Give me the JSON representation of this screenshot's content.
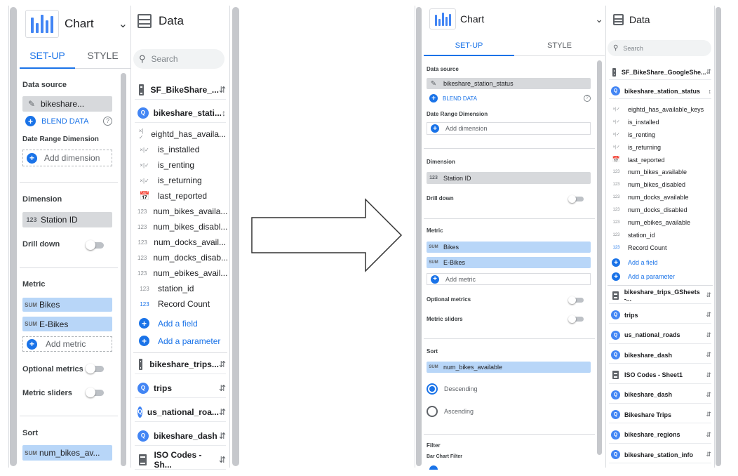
{
  "left": {
    "chart": {
      "title": "Chart"
    },
    "data": {
      "title": "Data",
      "search_placeholder": "Search"
    },
    "tabs": {
      "setup": "SET-UP",
      "style": "STYLE"
    },
    "data_source": {
      "label": "Data source",
      "value": "bikeshare...",
      "blend": "BLEND DATA",
      "help": "?"
    },
    "date_range": {
      "label": "Date Range Dimension",
      "add": "Add dimension"
    },
    "dimension": {
      "label": "Dimension",
      "tag": "123",
      "value": "Station ID",
      "drill": "Drill down"
    },
    "metric": {
      "label": "Metric",
      "items": [
        {
          "tag": "SUM",
          "name": "Bikes"
        },
        {
          "tag": "SUM",
          "name": "E-Bikes"
        }
      ],
      "add": "Add metric",
      "optional": "Optional metrics",
      "sliders": "Metric sliders"
    },
    "sort": {
      "label": "Sort",
      "tag": "SUM",
      "value": "num_bikes_av..."
    },
    "sources_top": [
      "SF_BikeShare_...",
      "bikeshare_stati..."
    ],
    "fields": [
      {
        "t": "×|✓",
        "n": "eightd_has_availa..."
      },
      {
        "t": "×|✓",
        "n": "is_installed"
      },
      {
        "t": "×|✓",
        "n": "is_renting"
      },
      {
        "t": "×|✓",
        "n": "is_returning"
      },
      {
        "t": "cal",
        "n": "last_reported"
      },
      {
        "t": "123",
        "n": "num_bikes_availa..."
      },
      {
        "t": "123",
        "n": "num_bikes_disabl..."
      },
      {
        "t": "123",
        "n": "num_docks_avail..."
      },
      {
        "t": "123",
        "n": "num_docks_disab..."
      },
      {
        "t": "123",
        "n": "num_ebikes_avail..."
      },
      {
        "t": "123",
        "n": "station_id"
      },
      {
        "t": "123",
        "n": "Record Count"
      }
    ],
    "add_field": "Add a field",
    "add_parameter": "Add a parameter",
    "sources_bottom": [
      {
        "icon": "sheet",
        "n": "bikeshare_trips..."
      },
      {
        "icon": "bq",
        "n": "trips"
      },
      {
        "icon": "bq",
        "n": "us_national_roa..."
      },
      {
        "icon": "bq",
        "n": "bikeshare_dash"
      },
      {
        "icon": "sheet",
        "n": "ISO Codes - Sh..."
      }
    ]
  },
  "right": {
    "chart": {
      "title": "Chart"
    },
    "data": {
      "title": "Data",
      "search_placeholder": "Search"
    },
    "tabs": {
      "setup": "SET-UP",
      "style": "STYLE"
    },
    "data_source": {
      "label": "Data source",
      "value": "bikeshare_station_status",
      "blend": "BLEND DATA",
      "help": "?"
    },
    "date_range": {
      "label": "Date Range Dimension",
      "add": "Add dimension"
    },
    "dimension": {
      "label": "Dimension",
      "tag": "123",
      "value": "Station ID",
      "drill": "Drill down"
    },
    "metric": {
      "label": "Metric",
      "items": [
        {
          "tag": "SUM",
          "name": "Bikes"
        },
        {
          "tag": "SUM",
          "name": "E-Bikes"
        }
      ],
      "add": "Add metric",
      "optional": "Optional metrics",
      "sliders": "Metric sliders"
    },
    "sort": {
      "label": "Sort",
      "tag": "SUM",
      "value": "num_bikes_available",
      "desc": "Descending",
      "asc": "Ascending"
    },
    "filter": {
      "label": "Filter",
      "sub": "Bar Chart Filter"
    },
    "sources_top": [
      "SF_BikeShare_GoogleShe...",
      "bikeshare_station_status"
    ],
    "fields": [
      {
        "t": "×|✓",
        "n": "eightd_has_available_keys"
      },
      {
        "t": "×|✓",
        "n": "is_installed"
      },
      {
        "t": "×|✓",
        "n": "is_renting"
      },
      {
        "t": "×|✓",
        "n": "is_returning"
      },
      {
        "t": "cal",
        "n": "last_reported"
      },
      {
        "t": "123",
        "n": "num_bikes_available"
      },
      {
        "t": "123",
        "n": "num_bikes_disabled"
      },
      {
        "t": "123",
        "n": "num_docks_available"
      },
      {
        "t": "123",
        "n": "num_docks_disabled"
      },
      {
        "t": "123",
        "n": "num_ebikes_available"
      },
      {
        "t": "123",
        "n": "station_id"
      },
      {
        "t": "123",
        "n": "Record Count"
      }
    ],
    "add_field": "Add a field",
    "add_parameter": "Add a parameter",
    "sources_bottom": [
      {
        "icon": "sheet",
        "n": "bikeshare_trips_GSheets -..."
      },
      {
        "icon": "bq",
        "n": "trips"
      },
      {
        "icon": "bq",
        "n": "us_national_roads"
      },
      {
        "icon": "bq",
        "n": "bikeshare_dash"
      },
      {
        "icon": "sheet",
        "n": "ISO Codes - Sheet1"
      },
      {
        "icon": "bq",
        "n": "bikeshare_dash"
      },
      {
        "icon": "bq",
        "n": "Bikeshare Trips"
      },
      {
        "icon": "bq",
        "n": "bikeshare_regions"
      },
      {
        "icon": "bq",
        "n": "bikeshare_station_info"
      }
    ]
  },
  "colors": {
    "accent": "#1a73e8",
    "chip_blue": "#b8d6f8",
    "chip_grey": "#d7d9dc"
  }
}
